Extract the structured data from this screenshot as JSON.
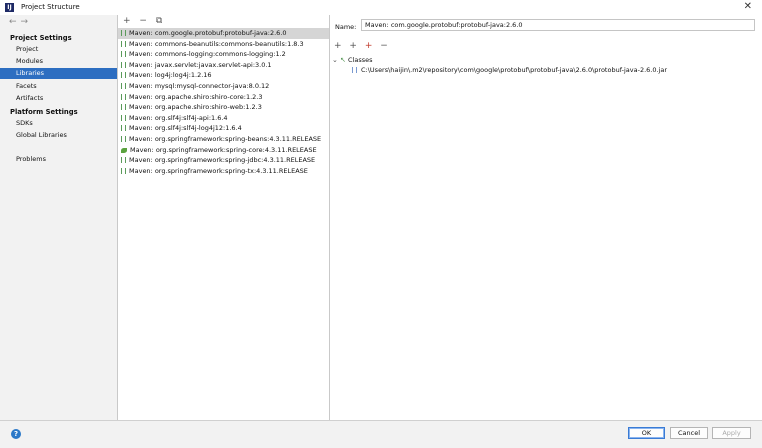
{
  "window": {
    "app_icon": "IJ",
    "title": "Project Structure",
    "close_glyph": "✕"
  },
  "sidebar": {
    "nav_back": "←",
    "nav_forward": "→",
    "sections": [
      {
        "header": "Project Settings",
        "items": [
          "Project",
          "Modules",
          "Libraries",
          "Facets",
          "Artifacts"
        ]
      },
      {
        "header": "Platform Settings",
        "items": [
          "SDKs",
          "Global Libraries"
        ]
      }
    ],
    "extra_items": [
      "Problems"
    ],
    "selected": "Libraries"
  },
  "libraries_toolbar": {
    "add": "+",
    "remove": "−",
    "copy": "⧉"
  },
  "libraries": [
    {
      "label": "Maven: com.google.protobuf:protobuf-java:2.6.0",
      "icon": "library-icon",
      "selected": true
    },
    {
      "label": "Maven: commons-beanutils:commons-beanutils:1.8.3",
      "icon": "library-icon"
    },
    {
      "label": "Maven: commons-logging:commons-logging:1.2",
      "icon": "library-icon"
    },
    {
      "label": "Maven: javax.servlet:javax.servlet-api:3.0.1",
      "icon": "library-icon"
    },
    {
      "label": "Maven: log4j:log4j:1.2.16",
      "icon": "library-icon"
    },
    {
      "label": "Maven: mysql:mysql-connector-java:8.0.12",
      "icon": "library-icon"
    },
    {
      "label": "Maven: org.apache.shiro:shiro-core:1.2.3",
      "icon": "library-icon"
    },
    {
      "label": "Maven: org.apache.shiro:shiro-web:1.2.3",
      "icon": "library-icon"
    },
    {
      "label": "Maven: org.slf4j:slf4j-api:1.6.4",
      "icon": "library-icon"
    },
    {
      "label": "Maven: org.slf4j:slf4j-log4j12:1.6.4",
      "icon": "library-icon"
    },
    {
      "label": "Maven: org.springframework:spring-beans:4.3.11.RELEASE",
      "icon": "library-icon"
    },
    {
      "label": "Maven: org.springframework:spring-core:4.3.11.RELEASE",
      "icon": "spring-icon"
    },
    {
      "label": "Maven: org.springframework:spring-jdbc:4.3.11.RELEASE",
      "icon": "library-icon"
    },
    {
      "label": "Maven: org.springframework:spring-tx:4.3.11.RELEASE",
      "icon": "library-icon"
    }
  ],
  "detail": {
    "name_label": "Name:",
    "name_value": "Maven: com.google.protobuf:protobuf-java:2.6.0",
    "toolbar": {
      "add": "+",
      "add_classes": "+",
      "add_root": "+",
      "remove": "−"
    },
    "tree": {
      "root_label": "Classes",
      "chevron": "⌄",
      "classes_icon_glyph": "↖",
      "children": [
        "C:\\Users\\haijin\\.m2\\repository\\com\\google\\protobuf\\protobuf-java\\2.6.0\\protobuf-java-2.6.0.jar"
      ]
    }
  },
  "footer": {
    "help": "?",
    "ok": "OK",
    "cancel": "Cancel",
    "apply": "Apply"
  },
  "colors": {
    "selection": "#2d6ec1",
    "ok_border": "#3a7bd5",
    "help": "#2a78c8"
  }
}
